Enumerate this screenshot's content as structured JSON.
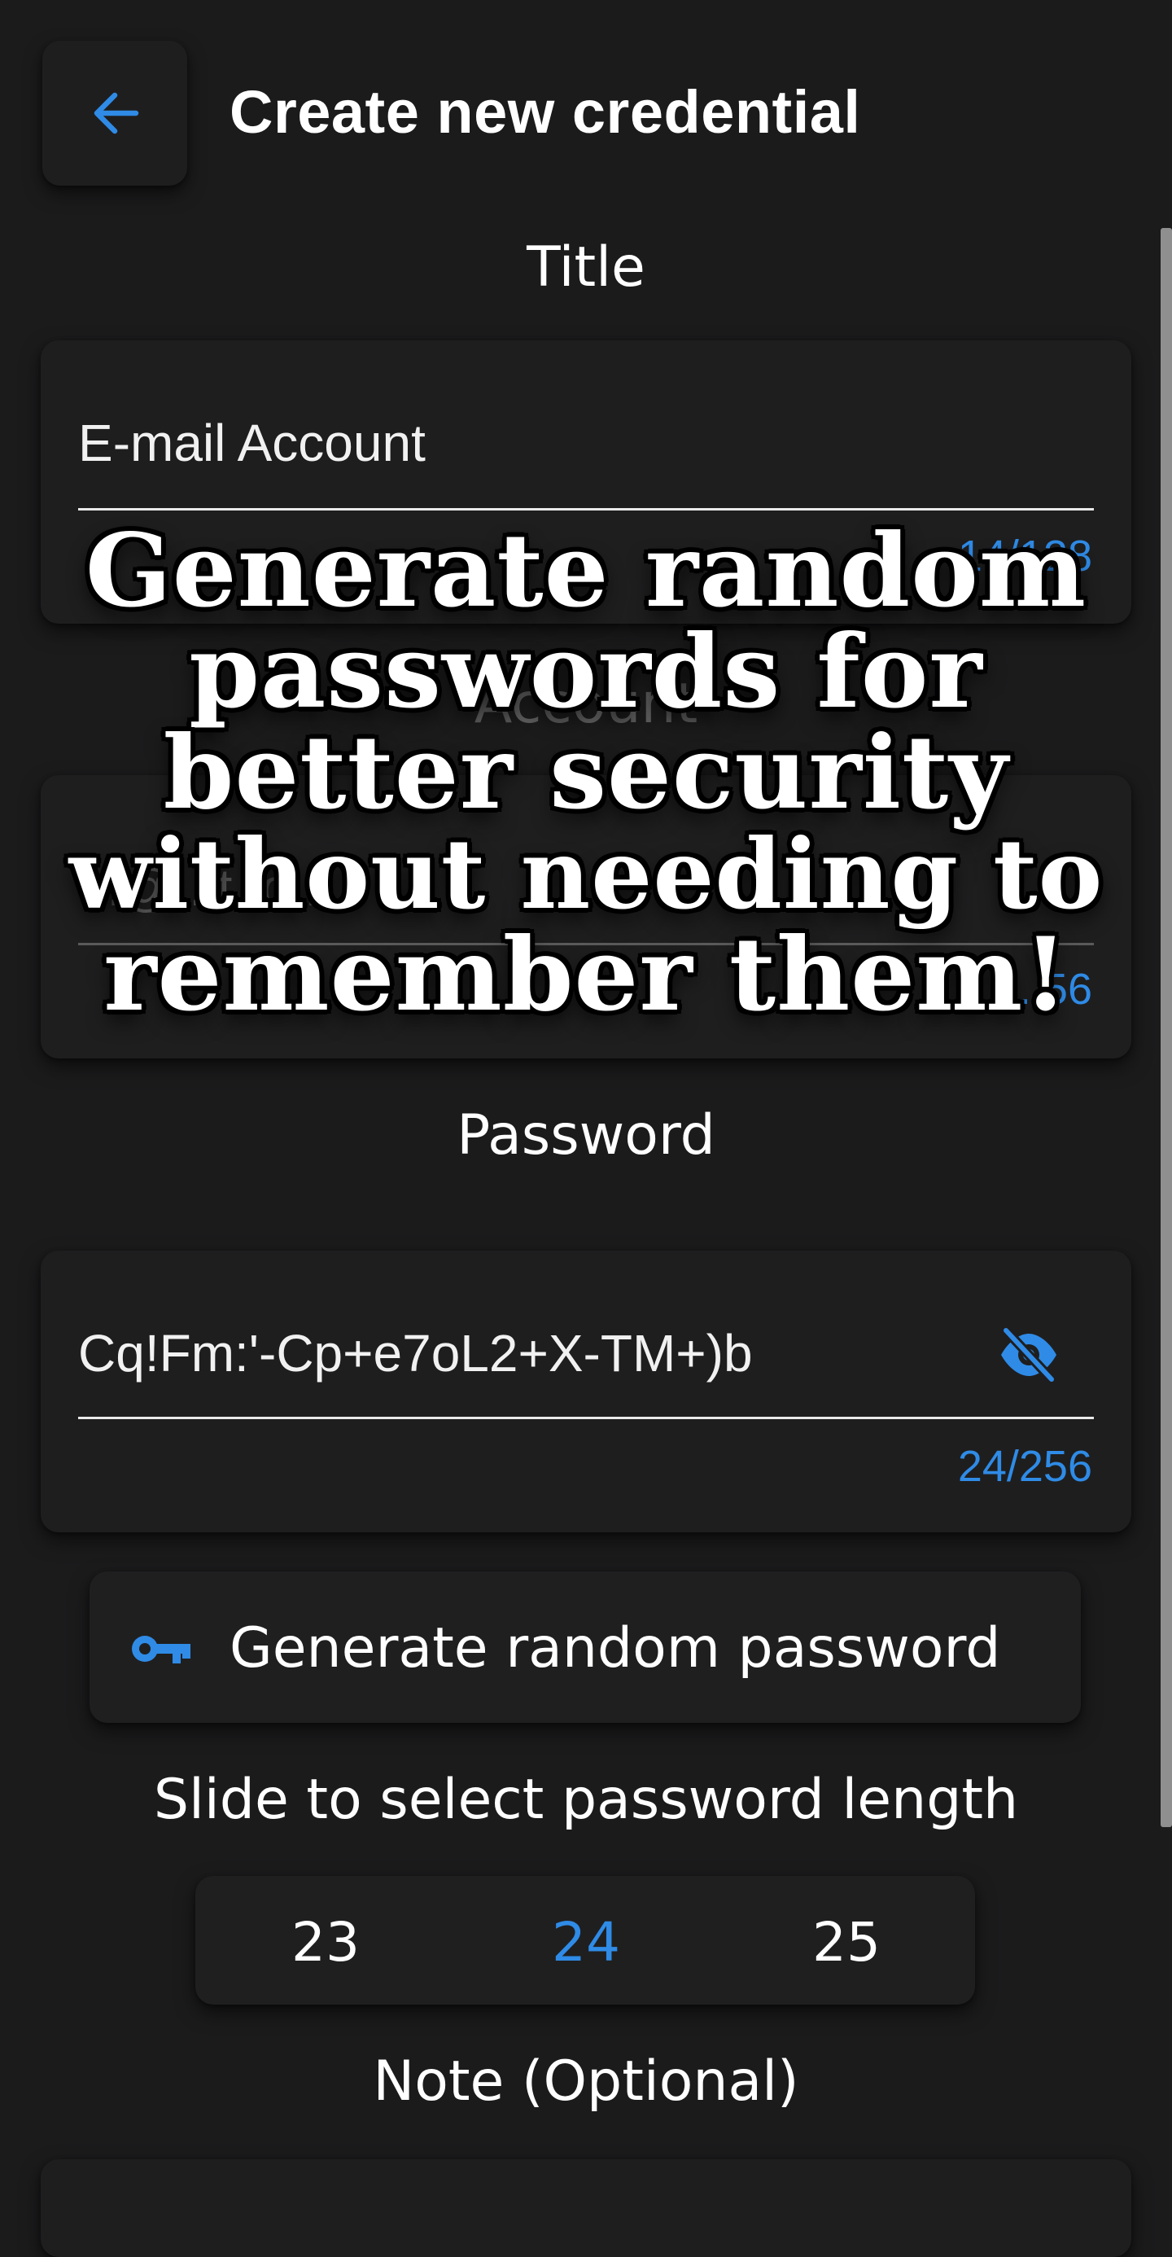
{
  "header": {
    "title": "Create new credential",
    "back_icon": "arrow-left-icon"
  },
  "title_field": {
    "label": "Title",
    "value": "E-mail Account",
    "counter": "14/128"
  },
  "account_field": {
    "label": "Account",
    "value": "...@...t.to...",
    "counter": "...56"
  },
  "password_field": {
    "label": "Password",
    "value": "Cq!Fm:'-Cp+e7oL2+X-TM+)b",
    "counter": "24/256",
    "visibility_icon": "eye-off-icon"
  },
  "generate_button": {
    "label": "Generate random password",
    "icon": "key-icon"
  },
  "length_picker": {
    "label": "Slide to select password length",
    "options": [
      "23",
      "24",
      "25"
    ],
    "selected": "24"
  },
  "note_field": {
    "label": "Note (Optional)"
  },
  "overlay": {
    "lines": [
      "Generate random",
      "passwords for",
      "better security",
      "without needing to",
      "remember them!"
    ]
  },
  "colors": {
    "background": "#1b1b1c",
    "card": "#1e1e1f",
    "accent": "#2f8be6",
    "text": "#ffffff"
  }
}
